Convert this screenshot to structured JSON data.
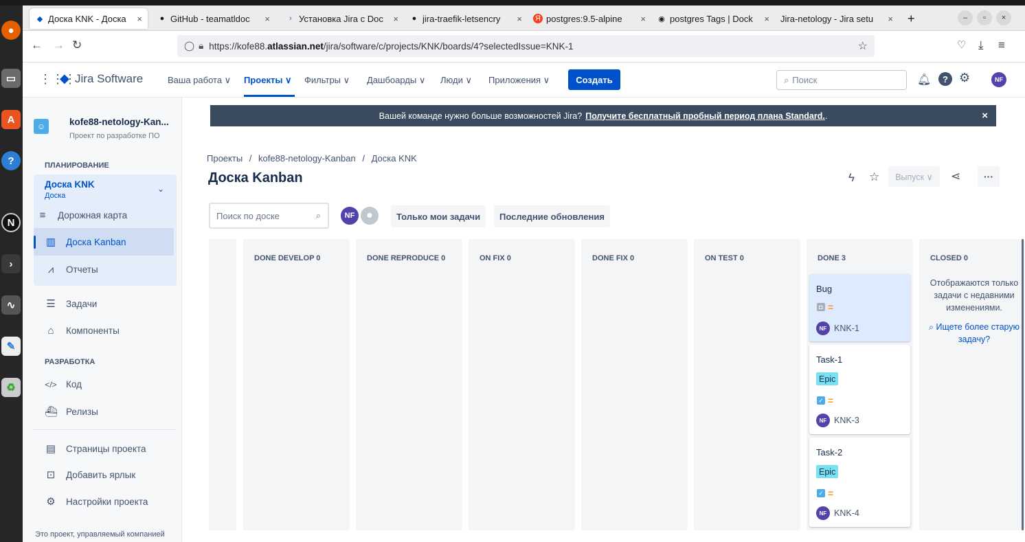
{
  "browser": {
    "tabs": [
      {
        "label": "Доска KNK - Доска",
        "icon": "jira-icon"
      },
      {
        "label": "GitHub - teamatldoc",
        "icon": "github-icon"
      },
      {
        "label": "Установка Jira с Doc",
        "icon": "chevron-icon"
      },
      {
        "label": "jira-traefik-letsencry",
        "icon": "github-icon"
      },
      {
        "label": "postgres:9.5-alpine",
        "icon": "yandex-icon"
      },
      {
        "label": "postgres Tags | Dock",
        "icon": "globe-icon"
      },
      {
        "label": "Jira-netology - Jira setu",
        "icon": ""
      }
    ],
    "new_tab": "+",
    "url_prefix": "https://kofe88.",
    "url_host": "atlassian.net",
    "url_path": "/jira/software/c/projects/KNK/boards/4?selectedIssue=KNK-1"
  },
  "header": {
    "product": "Jira Software",
    "nav": [
      "Ваша работа ∨",
      "Проекты ∨",
      "Фильтры ∨",
      "Дашбоарды ∨",
      "Люди ∨",
      "Приложения ∨"
    ],
    "create": "Создать",
    "search_placeholder": "Поиск",
    "avatar": "NF"
  },
  "sidebar": {
    "project_name": "kofe88-netology-Kan...",
    "project_type": "Проект по разработке ПО",
    "section_planning": "ПЛАНИРОВАНИЕ",
    "board_group": {
      "title": "Доска KNK",
      "subtitle": "Доска"
    },
    "items_planning": [
      "Дорожная карта",
      "Доска Kanban",
      "Отчеты"
    ],
    "items_mid": [
      "Задачи",
      "Компоненты"
    ],
    "section_dev": "РАЗРАБОТКА",
    "items_dev": [
      "Код",
      "Релизы"
    ],
    "items_bottom": [
      "Страницы проекта",
      "Добавить ярлык",
      "Настройки проекта"
    ],
    "footer": "Это проект, управляемый компанией"
  },
  "banner": {
    "text": "Вашей команде нужно больше возможностей Jira?",
    "link": "Получите бесплатный пробный период плана Standard.",
    "tail": "."
  },
  "breadcrumb": [
    "Проекты",
    "kofe88-netology-Kanban",
    "Доска KNK"
  ],
  "page_title": "Доска Kanban",
  "release_label": "Выпуск ∨",
  "board_search_placeholder": "Поиск по доске",
  "avatar_initials": "NF",
  "filters": [
    "Только мои задачи",
    "Последние обновления"
  ],
  "columns": [
    {
      "title": ""
    },
    {
      "title": "DONE DEVELOP 0"
    },
    {
      "title": "DONE REPRODUCE 0"
    },
    {
      "title": "ON FIX 0"
    },
    {
      "title": "DONE FIX 0"
    },
    {
      "title": "ON TEST 0"
    },
    {
      "title": "DONE 3"
    },
    {
      "title": "CLOSED 0"
    }
  ],
  "cards": [
    {
      "title": "Bug",
      "key": "KNK-1",
      "type": "story",
      "epic": ""
    },
    {
      "title": "Task-1",
      "key": "KNK-3",
      "type": "task",
      "epic": "Epic"
    },
    {
      "title": "Task-2",
      "key": "KNK-4",
      "type": "task",
      "epic": "Epic"
    }
  ],
  "closed_note": "Отображаются только задачи с недавними изменениями.",
  "closed_link": "Ищете более старую задачу?",
  "colors": {
    "accent": "#0052cc",
    "epic": "#79e2f2",
    "selected_card": "#deebff",
    "banner": "#3a4a5f"
  }
}
